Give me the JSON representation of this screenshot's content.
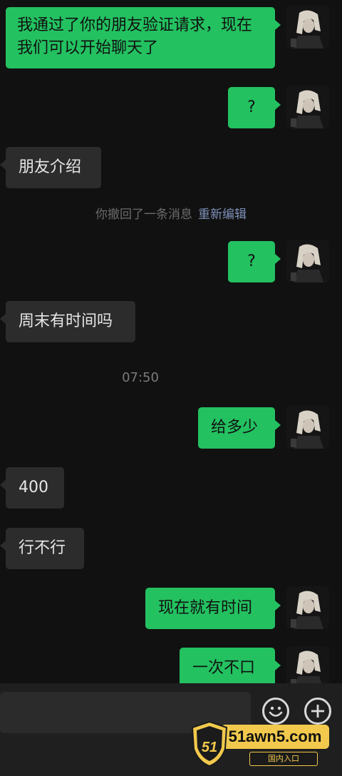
{
  "messages": [
    {
      "dir": "out",
      "text": "我通过了你的朋友验证请求，现在我们可以开始聊天了"
    },
    {
      "dir": "out",
      "text": "?"
    },
    {
      "dir": "in",
      "text": "朋友介绍"
    },
    {
      "dir": "system",
      "text": "你撤回了一条消息",
      "link": "重新编辑"
    },
    {
      "dir": "out",
      "text": "?"
    },
    {
      "dir": "in",
      "text": "周末有时间吗"
    },
    {
      "dir": "time",
      "text": "07:50"
    },
    {
      "dir": "out",
      "text": "给多少"
    },
    {
      "dir": "in",
      "text": "400"
    },
    {
      "dir": "in",
      "text": "行不行"
    },
    {
      "dir": "out",
      "text": "现在就有时间"
    },
    {
      "dir": "out",
      "text": "一次不口"
    }
  ],
  "input_bar": {
    "emoji_icon": "smiley-face-icon",
    "more_icon": "plus-icon"
  },
  "watermark": {
    "shield_text": "51",
    "site": "51awn5.com",
    "sub": "国内入口"
  },
  "colors": {
    "outgoing_bubble": "#23c160",
    "incoming_bubble": "#2c2c2c",
    "background": "#111111",
    "recall_link": "#7d90b8"
  }
}
